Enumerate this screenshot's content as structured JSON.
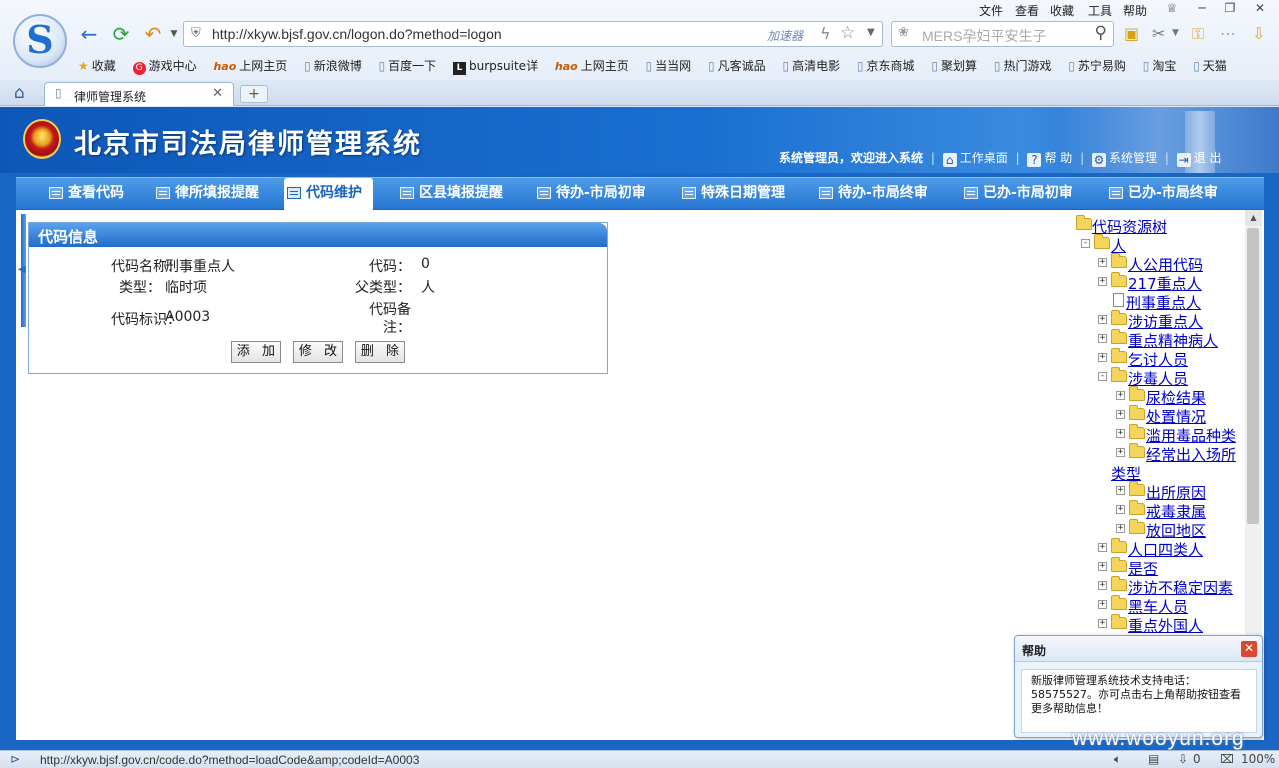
{
  "browser": {
    "menu": [
      "文件",
      "查看",
      "收藏",
      "工具",
      "帮助"
    ],
    "address_url": "http://xkyw.bjsf.gov.cn/logon.do?method=logon",
    "accelerator_label": "加速器",
    "search_placeholder": "MERS孕妇平安生子",
    "bookmarks": [
      "收藏",
      "游戏中心",
      "上网主页",
      "新浪微博",
      "百度一下",
      "burpsuite详",
      "上网主页",
      "当当网",
      "凡客诚品",
      "高清电影",
      "京东商城",
      "聚划算",
      "热门游戏",
      "苏宁易购",
      "淘宝",
      "天猫"
    ],
    "tab_title": "律师管理系统",
    "status_url": "http://xkyw.bjsf.gov.cn/code.do?method=loadCode&amp;codeId=A0003",
    "status_count": "0",
    "zoom": "100%"
  },
  "header": {
    "title": "北京市司法局律师管理系统",
    "welcome": "系统管理员，欢迎进入系统",
    "links": [
      "工作桌面",
      "帮 助",
      "系统管理",
      "退 出"
    ]
  },
  "nav": {
    "tabs": [
      "查看代码",
      "律所填报提醒",
      "代码维护",
      "区县填报提醒",
      "待办-市局初审",
      "特殊日期管理",
      "待办-市局终审",
      "已办-市局初审",
      "已办-市局终审"
    ],
    "active": "代码维护"
  },
  "panel": {
    "title": "代码信息",
    "fields": {
      "code_name_label": "代码名称：",
      "code_name": "刑事重点人",
      "code_label": "代码：",
      "code": "0",
      "type_label": "类型：",
      "type": "临时项",
      "parent_type_label": "父类型：",
      "parent_type": "人",
      "code_id_label": "代码标识：",
      "code_id": "A0003",
      "remark_label_line1": "代码备",
      "remark_label_line2": "注：",
      "remark": ""
    },
    "buttons": {
      "add": "添 加",
      "edit": "修 改",
      "delete": "删 除"
    }
  },
  "tree": {
    "root": "代码资源树",
    "nodes": [
      {
        "label": "人",
        "level": 1,
        "kind": "folder",
        "exp": "-"
      },
      {
        "label": "人公用代码",
        "level": 2,
        "kind": "folder",
        "exp": "+"
      },
      {
        "label": "217重点人",
        "level": 2,
        "kind": "folder",
        "exp": "+"
      },
      {
        "label": "刑事重点人",
        "level": 2,
        "kind": "doc",
        "exp": ""
      },
      {
        "label": "涉访重点人",
        "level": 2,
        "kind": "folder",
        "exp": "+"
      },
      {
        "label": "重点精神病人",
        "level": 2,
        "kind": "folder",
        "exp": "+"
      },
      {
        "label": "乞讨人员",
        "level": 2,
        "kind": "folder",
        "exp": "+"
      },
      {
        "label": "涉毒人员",
        "level": 2,
        "kind": "folder",
        "exp": "-"
      },
      {
        "label": "尿检结果",
        "level": 3,
        "kind": "folder",
        "exp": "+"
      },
      {
        "label": "处置情况",
        "level": 3,
        "kind": "folder",
        "exp": "+"
      },
      {
        "label": "滥用毒品种类",
        "level": 3,
        "kind": "folder",
        "exp": "+"
      },
      {
        "label": "经常出入场所",
        "level": 3,
        "kind": "folder",
        "exp": "+"
      },
      {
        "label": "类型",
        "level": 0,
        "kind": "wrap",
        "exp": ""
      },
      {
        "label": "出所原因",
        "level": 3,
        "kind": "folder",
        "exp": "+"
      },
      {
        "label": "戒毒隶属",
        "level": 3,
        "kind": "folder",
        "exp": "+"
      },
      {
        "label": "放回地区",
        "level": 3,
        "kind": "folder",
        "exp": "+"
      },
      {
        "label": "人口四类人",
        "level": 2,
        "kind": "folder",
        "exp": "+"
      },
      {
        "label": "是否",
        "level": 2,
        "kind": "folder",
        "exp": "+"
      },
      {
        "label": "涉访不稳定因素",
        "level": 2,
        "kind": "folder",
        "exp": "+"
      },
      {
        "label": "黑车人员",
        "level": 2,
        "kind": "folder",
        "exp": "+"
      },
      {
        "label": "重点外国人",
        "level": 2,
        "kind": "folder",
        "exp": "+"
      }
    ]
  },
  "help": {
    "title": "帮助",
    "text": "新版律师管理系统技术支持电话：58575527。亦可点击右上角帮助按钮查看更多帮助信息！"
  },
  "watermark": "www.wooyun.org"
}
